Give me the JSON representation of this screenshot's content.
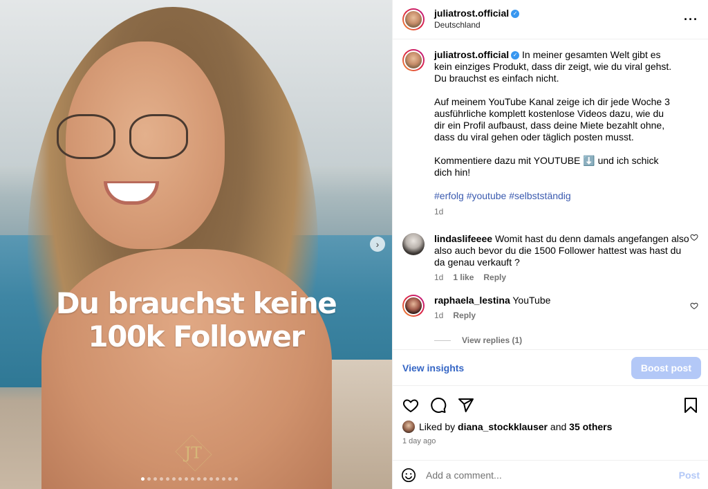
{
  "post": {
    "overlay_line1": "Du brauchst keine",
    "overlay_line2": "100k Follower",
    "logo_text": "JT",
    "carousel_count": 16,
    "carousel_active": 0
  },
  "header": {
    "username": "juliatrost.official",
    "location": "Deutschland",
    "verified": true
  },
  "caption": {
    "username": "juliatrost.official",
    "para1": "In meiner gesamten Welt gibt es kein einziges Produkt, dass dir zeigt, wie du viral gehst. Du brauchst es einfach nicht.",
    "para2": "Auf meinem YouTube Kanal zeige ich dir jede Woche 3 ausführliche komplett kostenlose Videos dazu, wie du dir ein Profil aufbaust, dass deine Miete bezahlt ohne, dass du viral gehen oder täglich posten musst.",
    "para3": "Kommentiere dazu mit YOUTUBE ⬇️ und ich schick dich hin!",
    "hashtags": "#erfolg #youtube #selbstständig",
    "time": "1d"
  },
  "comments": [
    {
      "username": "lindaslifeeee",
      "text": "Womit hast du denn damals angefangen also also auch bevor du die 1500 Follower hattest was hast du da genau verkauft ?",
      "time": "1d",
      "likes": "1 like",
      "reply": "Reply"
    },
    {
      "username": "raphaela_lestina",
      "text": "YouTube",
      "time": "1d",
      "reply": "Reply"
    }
  ],
  "view_replies": "View replies (1)",
  "insights": {
    "link": "View insights",
    "boost": "Boost post"
  },
  "likes": {
    "prefix": "Liked by",
    "user": "diana_stockklauser",
    "and": "and",
    "others": "35 others"
  },
  "date": "1 day ago",
  "add_comment": {
    "placeholder": "Add a comment...",
    "post": "Post"
  }
}
